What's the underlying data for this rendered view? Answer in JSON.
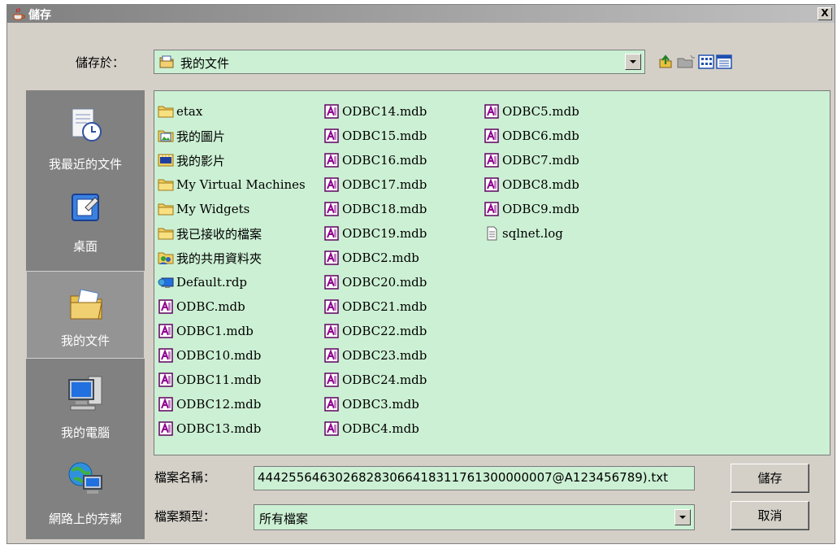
{
  "window": {
    "title": "儲存",
    "close_glyph": "X"
  },
  "save_in": {
    "label": "儲存於：",
    "value": "我的文件",
    "icon": "my-documents-icon"
  },
  "toolbar": {
    "icons": [
      "up-folder-icon",
      "new-folder-icon",
      "list-view-icon",
      "details-view-icon"
    ]
  },
  "places": [
    {
      "label": "我最近的文件",
      "icon": "recent-documents-icon"
    },
    {
      "label": "桌面",
      "icon": "desktop-icon"
    },
    {
      "label": "我的文件",
      "icon": "my-documents-folder-icon",
      "selected": true
    },
    {
      "label": "我的電腦",
      "icon": "my-computer-icon"
    },
    {
      "label": "網路上的芳鄰",
      "icon": "network-places-icon"
    }
  ],
  "files": {
    "col1": [
      {
        "name": "etax",
        "icon": "folder-icon"
      },
      {
        "name": "我的圖片",
        "icon": "pictures-folder-icon"
      },
      {
        "name": "我的影片",
        "icon": "videos-folder-icon"
      },
      {
        "name": "My Virtual Machines",
        "icon": "folder-icon"
      },
      {
        "name": "My Widgets",
        "icon": "folder-icon"
      },
      {
        "name": "我已接收的檔案",
        "icon": "folder-icon"
      },
      {
        "name": "我的共用資料夾",
        "icon": "shared-folder-icon"
      },
      {
        "name": "Default.rdp",
        "icon": "remote-desktop-file-icon"
      },
      {
        "name": "ODBC.mdb",
        "icon": "access-db-icon"
      },
      {
        "name": "ODBC1.mdb",
        "icon": "access-db-icon"
      },
      {
        "name": "ODBC10.mdb",
        "icon": "access-db-icon"
      },
      {
        "name": "ODBC11.mdb",
        "icon": "access-db-icon"
      },
      {
        "name": "ODBC12.mdb",
        "icon": "access-db-icon"
      },
      {
        "name": "ODBC13.mdb",
        "icon": "access-db-icon"
      }
    ],
    "col2": [
      {
        "name": "ODBC14.mdb",
        "icon": "access-db-icon"
      },
      {
        "name": "ODBC15.mdb",
        "icon": "access-db-icon"
      },
      {
        "name": "ODBC16.mdb",
        "icon": "access-db-icon"
      },
      {
        "name": "ODBC17.mdb",
        "icon": "access-db-icon"
      },
      {
        "name": "ODBC18.mdb",
        "icon": "access-db-icon"
      },
      {
        "name": "ODBC19.mdb",
        "icon": "access-db-icon"
      },
      {
        "name": "ODBC2.mdb",
        "icon": "access-db-icon"
      },
      {
        "name": "ODBC20.mdb",
        "icon": "access-db-icon"
      },
      {
        "name": "ODBC21.mdb",
        "icon": "access-db-icon"
      },
      {
        "name": "ODBC22.mdb",
        "icon": "access-db-icon"
      },
      {
        "name": "ODBC23.mdb",
        "icon": "access-db-icon"
      },
      {
        "name": "ODBC24.mdb",
        "icon": "access-db-icon"
      },
      {
        "name": "ODBC3.mdb",
        "icon": "access-db-icon"
      },
      {
        "name": "ODBC4.mdb",
        "icon": "access-db-icon"
      }
    ],
    "col3": [
      {
        "name": "ODBC5.mdb",
        "icon": "access-db-icon"
      },
      {
        "name": "ODBC6.mdb",
        "icon": "access-db-icon"
      },
      {
        "name": "ODBC7.mdb",
        "icon": "access-db-icon"
      },
      {
        "name": "ODBC8.mdb",
        "icon": "access-db-icon"
      },
      {
        "name": "ODBC9.mdb",
        "icon": "access-db-icon"
      },
      {
        "name": "sqlnet.log",
        "icon": "text-file-icon"
      }
    ]
  },
  "filename": {
    "label": "檔案名稱：",
    "value": "44425564630268283066418311761300000007@A123456789).txt"
  },
  "filetype": {
    "label": "檔案類型：",
    "value": "所有檔案"
  },
  "buttons": {
    "save": "儲存",
    "cancel": "取消"
  },
  "colors": {
    "list_bg": "#ccf0d4",
    "dialog_bg": "#d4d0c8",
    "sidebar_bg": "#818181"
  }
}
